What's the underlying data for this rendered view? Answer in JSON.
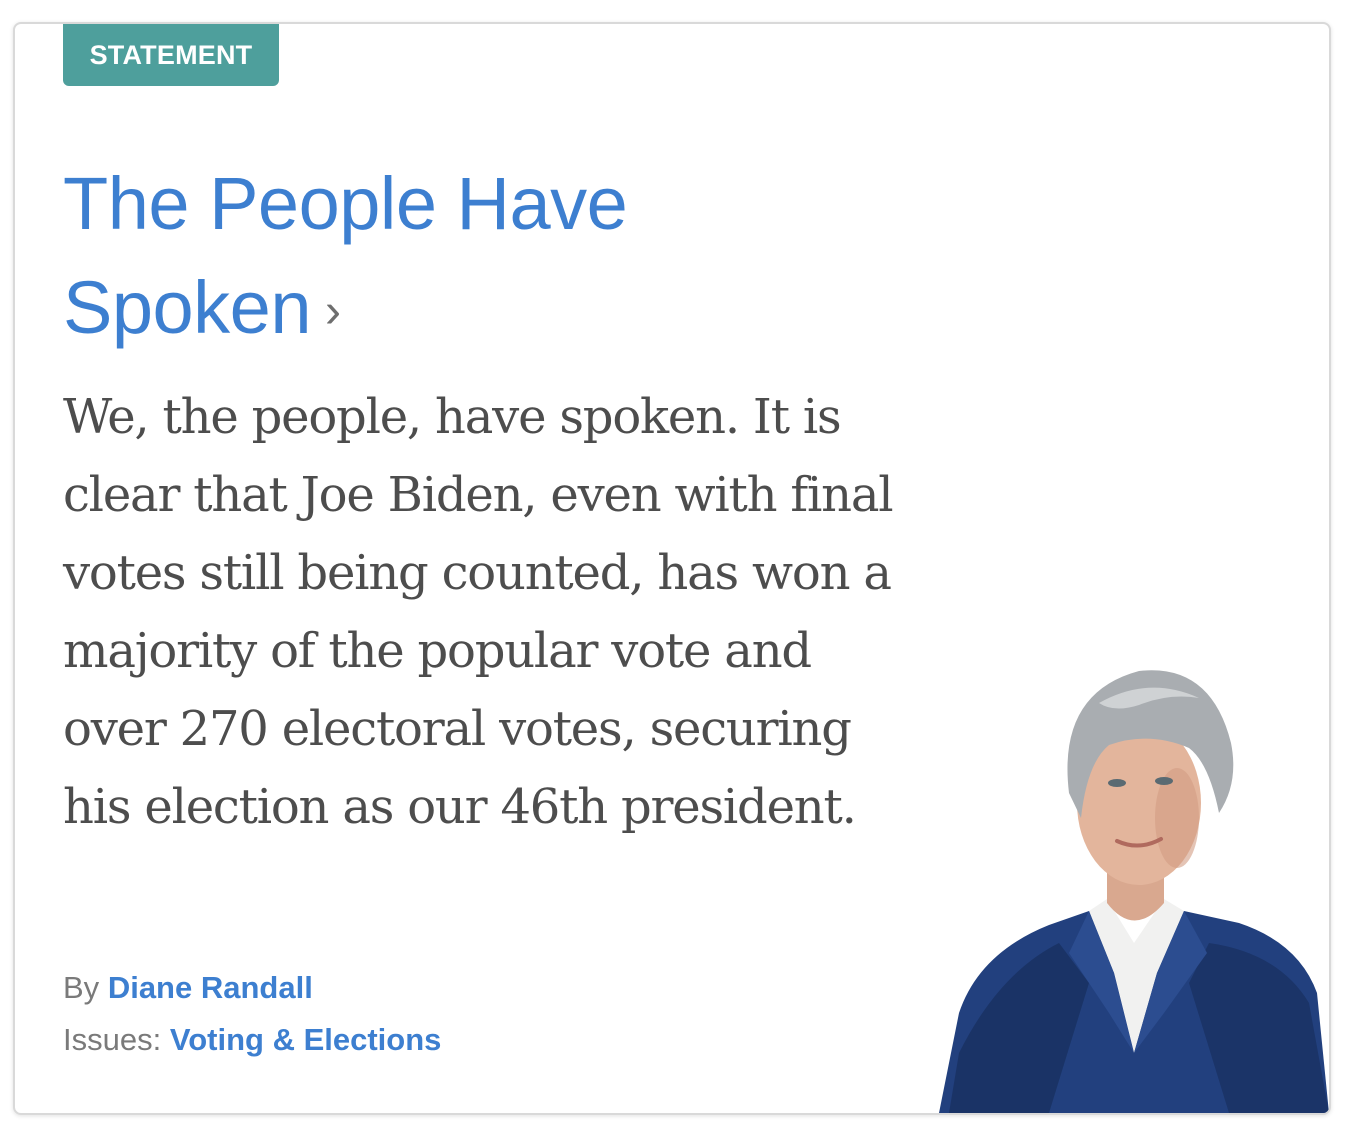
{
  "card": {
    "badge": "STATEMENT",
    "title": "The People Have Spoken",
    "title_chevron": "›",
    "excerpt": "We, the people, have spoken. It is clear that Joe Biden, even with final votes still being counted, has won a majority of the popular vote and over 270 electoral votes, securing his election as our 46th president.",
    "byline": {
      "prefix": "By",
      "author": "Diane Randall"
    },
    "issues": {
      "prefix": "Issues:",
      "topic": "Voting & Elections"
    }
  },
  "colors": {
    "badge_bg": "#4e9f9c",
    "link": "#3d7fd0",
    "body_text": "#4d4d4d",
    "meta_text": "#7a7a7a"
  },
  "icons": {
    "title_chevron": "chevron-right-icon"
  }
}
